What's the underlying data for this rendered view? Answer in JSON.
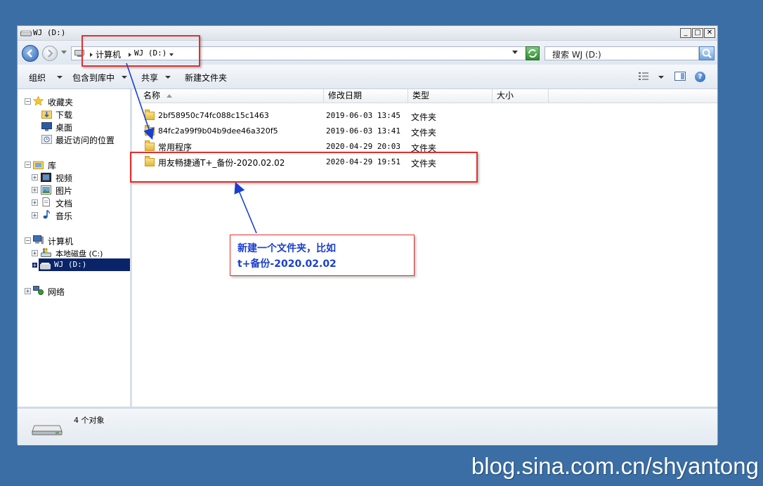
{
  "window": {
    "title": "WJ (D:)",
    "buttons": {
      "minimize": "_",
      "maximize": "□",
      "close": "✕"
    }
  },
  "address": {
    "crumbs": [
      "计算机",
      "WJ (D:)"
    ],
    "search_placeholder": "搜索 WJ (D:)"
  },
  "toolbar": {
    "organize": "组织",
    "include_in_library": "包含到库中",
    "share": "共享",
    "new_folder": "新建文件夹"
  },
  "nav": {
    "favorites": "收藏夹",
    "downloads": "下载",
    "desktop": "桌面",
    "recent": "最近访问的位置",
    "libraries": "库",
    "videos": "视频",
    "pictures": "图片",
    "documents": "文档",
    "music": "音乐",
    "computer": "计算机",
    "local_disk": "本地磁盘 (C:)",
    "wj_drive": "WJ (D:)",
    "network": "网络"
  },
  "columns": {
    "name": "名称",
    "modified": "修改日期",
    "type": "类型",
    "size": "大小"
  },
  "files": [
    {
      "name": "2bf58950c74fc088c15c1463",
      "modified": "2019-06-03 13:45",
      "type": "文件夹"
    },
    {
      "name": "84fc2a99f9b04b9dee46a320f5",
      "modified": "2019-06-03 13:41",
      "type": "文件夹"
    },
    {
      "name": "常用程序",
      "modified": "2020-04-29 20:03",
      "type": "文件夹"
    },
    {
      "name": "用友畅捷通T+_备份-2020.02.02",
      "modified": "2020-04-29 19:51",
      "type": "文件夹"
    }
  ],
  "status": {
    "count": "4 个对象"
  },
  "annotation": {
    "line1": "新建一个文件夹，比如",
    "line2": "t+备份-2020.02.02"
  },
  "watermark": "blog.sina.com.cn/shyantong",
  "colors": {
    "desktop": "#3a6ea5",
    "annotation_red": "#e52d2d",
    "annotation_blue": "#1a3fd0",
    "selection": "#0a246a"
  }
}
